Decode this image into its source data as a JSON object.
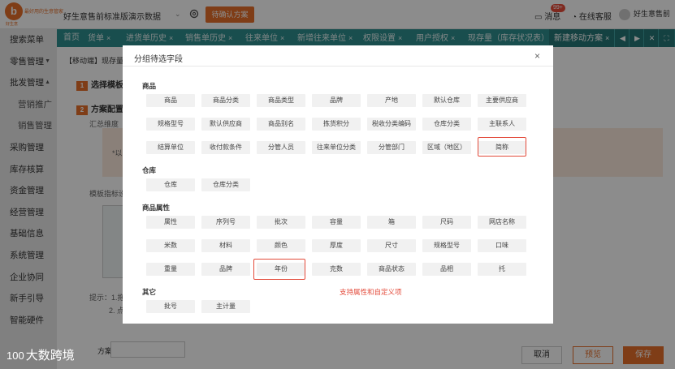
{
  "header": {
    "logo_letter": "b",
    "logo_tagline": "最好用的生意管家",
    "logo_sub": "好生意",
    "company": "好生意售前标准版演示数据",
    "pending_button": "待确认方案",
    "messages_label": "消息",
    "messages_badge": "99+",
    "service_label": "在线客服",
    "user_name": "好生意售前"
  },
  "sidebar": {
    "items": [
      {
        "label": "搜索菜单",
        "arrow": ""
      },
      {
        "label": "零售管理",
        "arrow": "▼"
      },
      {
        "label": "批发管理",
        "arrow": "▲"
      },
      {
        "label": "营销推广",
        "arrow": ""
      },
      {
        "label": "销售管理",
        "arrow": ""
      },
      {
        "label": "采购管理",
        "arrow": ""
      },
      {
        "label": "库存核算",
        "arrow": ""
      },
      {
        "label": "资金管理",
        "arrow": ""
      },
      {
        "label": "经营管理",
        "arrow": ""
      },
      {
        "label": "基础信息",
        "arrow": ""
      },
      {
        "label": "系统管理",
        "arrow": ""
      },
      {
        "label": "企业协同",
        "arrow": ""
      },
      {
        "label": "新手引导",
        "arrow": ""
      },
      {
        "label": "智能硬件",
        "arrow": ""
      }
    ]
  },
  "tabs": {
    "items": [
      {
        "label": "首页",
        "close": ""
      },
      {
        "label": "货单",
        "close": "×"
      },
      {
        "label": "进货单历史",
        "close": "×"
      },
      {
        "label": "销售单历史",
        "close": "×"
      },
      {
        "label": "往来单位",
        "close": "×"
      },
      {
        "label": "新增往来单位",
        "close": "×"
      },
      {
        "label": "权限设置",
        "close": "×"
      },
      {
        "label": "用户授权",
        "close": "×"
      },
      {
        "label": "现存量（库存状况表）",
        "close": "×"
      },
      {
        "label": "新建移动方案",
        "close": "×"
      }
    ],
    "nav": [
      "◀",
      "▶",
      "✕",
      "⛶"
    ]
  },
  "background_page": {
    "breadcrumb": "【移动端】现存量(库存",
    "step1_num": "1",
    "step1_label": "选择模板",
    "step2_num": "2",
    "step2_label": "方案配置",
    "summary_label": "汇总维度（",
    "hint_text": "*以",
    "metrics_label": "模板指标设",
    "tip_text": "提示：1.拖",
    "tip_text2": "2. 点",
    "scheme_name_label": "方案名称:",
    "cancel_button": "取消",
    "preview_button": "预览",
    "save_button": "保存"
  },
  "dialog": {
    "title": "分组待选字段",
    "close": "×",
    "sections": {
      "goods": {
        "title": "商品",
        "rows": [
          [
            "商品",
            "商品分类",
            "商品类型",
            "品牌",
            "产地",
            "默认仓库",
            "主要供应商"
          ],
          [
            "规格型号",
            "默认供应商",
            "商品别名",
            "拣货积分",
            "税收分类编码",
            "仓库分类",
            "主联系人"
          ],
          [
            "结算单位",
            "收付款条件",
            "分管人员",
            "往来单位分类",
            "分管部门",
            "区域（地区）",
            "简称"
          ]
        ]
      },
      "warehouse": {
        "title": "仓库",
        "rows": [
          [
            "仓库",
            "仓库分类"
          ]
        ]
      },
      "attributes": {
        "title": "商品属性",
        "rows": [
          [
            "属性",
            "序列号",
            "批次",
            "容量",
            "箱",
            "尺码",
            "网店名称"
          ],
          [
            "米数",
            "材料",
            "颜色",
            "厚度",
            "尺寸",
            "规格型号",
            "口味"
          ],
          [
            "重量",
            "品牌",
            "年份",
            "克数",
            "商品状态",
            "品相",
            "托"
          ]
        ]
      },
      "other": {
        "title": "其它",
        "rows": [
          [
            "批号",
            "主计量"
          ]
        ]
      }
    },
    "annotation": "支持属性和自定义项"
  },
  "watermark": {
    "mark": "100",
    "text": "大数跨境"
  },
  "colors": {
    "accent": "#e8702a",
    "tab_bar": "#2f8f8f",
    "highlight": "#e34a3a"
  }
}
